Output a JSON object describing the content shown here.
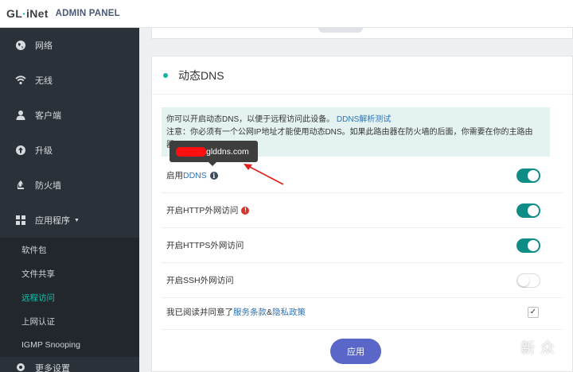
{
  "header": {
    "logo_prefix": "GL",
    "logo_dot": "·",
    "logo_suffix": "iNet",
    "panel_title": "ADMIN PANEL"
  },
  "sidebar": {
    "items": [
      {
        "label": "网络",
        "icon": "globe-icon"
      },
      {
        "label": "无线",
        "icon": "wifi-icon"
      },
      {
        "label": "客户端",
        "icon": "user-icon"
      },
      {
        "label": "升级",
        "icon": "upload-icon"
      },
      {
        "label": "防火墙",
        "icon": "firewall-icon"
      },
      {
        "label": "应用程序",
        "icon": "grid-icon",
        "caret": "▼"
      }
    ],
    "sub_items": [
      {
        "label": "软件包"
      },
      {
        "label": "文件共享"
      },
      {
        "label": "远程访问",
        "active": true
      },
      {
        "label": "上网认证"
      },
      {
        "label": "IGMP Snooping"
      }
    ],
    "bottom_label": "更多设置"
  },
  "card": {
    "title": "动态DNS",
    "info_line1": "你可以开启动态DNS，以便于远程访问此设备。",
    "info_link": "DDNS解析测试",
    "info_line2": "注意：你必须有一个公网IP地址才能使用动态DNS。如果此路由器在防火墙的后面，你需要在你的主路由",
    "info_line3": "器",
    "rows": [
      {
        "label_prefix": "启用 ",
        "label_link": "DDNS",
        "icon": "info-icon",
        "toggle": true
      },
      {
        "label": "开启HTTP外网访问",
        "icon": "warning-icon",
        "toggle": true
      },
      {
        "label": "开启HTTPS外网访问",
        "toggle": true
      },
      {
        "label": "开启SSH外网访问",
        "toggle": false
      }
    ],
    "agreement": {
      "prefix": "我已阅读并同意了 ",
      "terms": "服务条款",
      "and": " & ",
      "privacy": "隐私政策",
      "checked": true,
      "check_mark": "✓"
    },
    "apply_label": "应用"
  },
  "tooltip": {
    "text": "glddns.com"
  },
  "info_icon_glyph": "i",
  "warn_icon_glyph": "!",
  "watermark": "新 众",
  "colors": {
    "accent": "#16b3a2",
    "toggle_on": "#0e8d86",
    "apply": "#5a67c8",
    "sidebar": "#2b3138"
  }
}
